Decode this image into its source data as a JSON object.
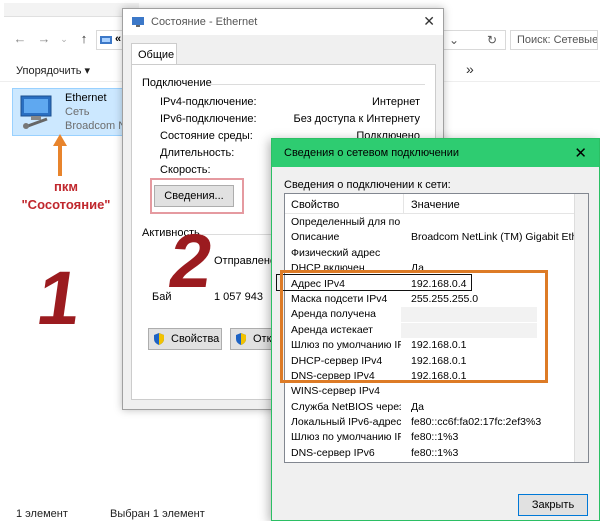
{
  "explorer": {
    "nav": {
      "back": "←",
      "forward": "→",
      "up": "↑",
      "addr_chevron": "«",
      "dropdown": "⌄",
      "refresh": "↻"
    },
    "search_placeholder": "Поиск: Сетевые",
    "toolbar": {
      "organize": "Упорядочить ▾",
      "more": "»",
      "c": "С"
    },
    "item": {
      "name": "Ethernet",
      "type": "Сеть",
      "adapter": "Broadcom N"
    },
    "statusbar": {
      "count": "1 элемент",
      "selected": "Выбран 1 элемент"
    }
  },
  "annotations": {
    "pkm_line1": "пкм",
    "pkm_line2": "\"Сосотояние\"",
    "step1": "1",
    "step2": "2"
  },
  "status_dialog": {
    "title": "Состояние - Ethernet",
    "close": "✕",
    "tab": "Общие",
    "section_connection": "Подключение",
    "rows": [
      {
        "label": "IPv4-подключение:",
        "value": "Интернет"
      },
      {
        "label": "IPv6-подключение:",
        "value": "Без доступа к Интернету"
      },
      {
        "label": "Состояние среды:",
        "value": "Подключено"
      },
      {
        "label": "Длительность:",
        "value": ""
      },
      {
        "label": "Скорость:",
        "value": ""
      }
    ],
    "details_button": "Сведения...",
    "section_activity": "Активность",
    "sent_label": "Отправлено",
    "bytes_label": "Бай",
    "bytes_value": "1 057 943",
    "properties_button": "Свойства",
    "disable_button": "Отключ"
  },
  "details_dialog": {
    "title": "Сведения о сетевом подключении",
    "close": "✕",
    "list_label": "Сведения о подключении к сети:",
    "col_property": "Свойство",
    "col_value": "Значение",
    "rows": [
      {
        "p": "Определенный для по...",
        "v": ""
      },
      {
        "p": "Описание",
        "v": "Broadcom NetLink (TM) Gigabit Ethernet"
      },
      {
        "p": "Физический адрес",
        "v": ""
      },
      {
        "p": "DHCP включен",
        "v": "Да"
      },
      {
        "p": "Адрес IPv4",
        "v": "192.168.0.4"
      },
      {
        "p": "Маска подсети IPv4",
        "v": "255.255.255.0"
      },
      {
        "p": "Аренда получена",
        "v": ""
      },
      {
        "p": "Аренда истекает",
        "v": ""
      },
      {
        "p": "Шлюз по умолчанию IP...",
        "v": "192.168.0.1"
      },
      {
        "p": "DHCP-сервер IPv4",
        "v": "192.168.0.1"
      },
      {
        "p": "DNS-сервер IPv4",
        "v": "192.168.0.1"
      },
      {
        "p": "WINS-сервер IPv4",
        "v": ""
      },
      {
        "p": "Служба NetBIOS через...",
        "v": "Да"
      },
      {
        "p": "Локальный IPv6-адрес...",
        "v": "fe80::cc6f:fa02:17fc:2ef3%3"
      },
      {
        "p": "Шлюз по умолчанию IP...",
        "v": "fe80::1%3"
      },
      {
        "p": "DNS-сервер IPv6",
        "v": "fe80::1%3"
      }
    ],
    "close_button": "Закрыть"
  }
}
